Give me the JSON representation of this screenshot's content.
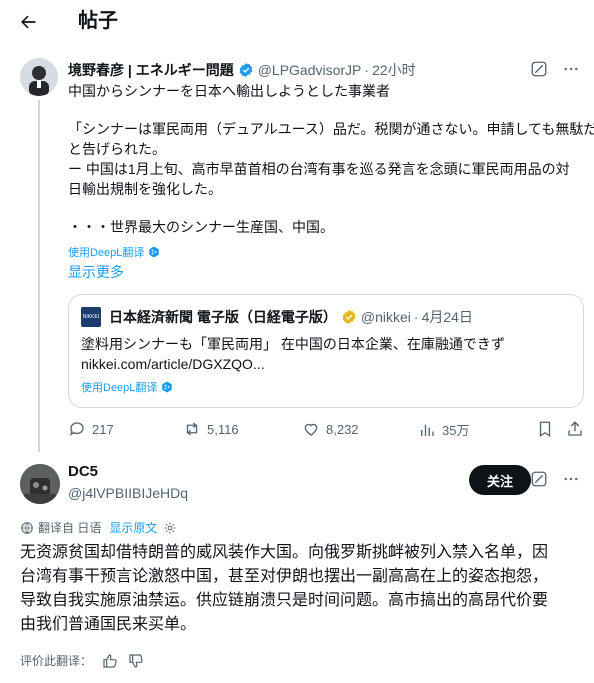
{
  "header": {
    "title": "帖子"
  },
  "post": {
    "author_name": "境野春彦 | エネルギー問題",
    "handle": "@LPGadvisorJP",
    "separator": "·",
    "time": "22小时",
    "lines": [
      "中国からシンナーを日本へ輸出しようとした事業者",
      "「シンナーは軍民両用（デュアルユース）品だ。税関が通さない。申請しても無駄だ」",
      "と告げられた。",
      "ー 中国は1月上旬、高市早苗首相の台湾有事を巡る発言を念頭に軍民両用品の対",
      "日輸出規制を強化した。",
      "・・・世界最大のシンナー生産国、中国。"
    ],
    "translate_label": "使用DeepL翻译",
    "show_more": "显示更多"
  },
  "quote": {
    "logo_text": "NIKKEI",
    "author_name": "日本経済新聞 電子版（日経電子版）",
    "handle": "@nikkei",
    "separator": "·",
    "date": "4月24日",
    "line1": "塗料用シンナーも「軍民両用」 在中国の日本企業、在庫融通できず",
    "line2": "nikkei.com/article/DGXZQO...",
    "translate_label": "使用DeepL翻译"
  },
  "actions": {
    "replies": "217",
    "reposts": "5,116",
    "likes": "8,232",
    "views": "35万"
  },
  "reply": {
    "author_name": "DC5",
    "handle": "@j4lVPBIIBIJeHDq",
    "follow_label": "关注",
    "translated_from": "翻译自 日语",
    "show_original": "显示原文",
    "lines": [
      "无资源贫国却借特朗普的威风装作大国。向俄罗斯挑衅被列入禁入名单，因",
      "台湾有事干预言论激怒中国，甚至对伊朗也摆出一副高高在上的姿态抱怨，",
      "导致自我实施原油禁运。供应链崩溃只是时间问题。高市搞出的高昂代价要",
      "由我们普通国民来买单。"
    ],
    "rate_label": "评价此翻译："
  },
  "icons": {
    "back": "arrow-left-icon",
    "verified": "verified-badge-icon",
    "grok": "grok-icon",
    "more": "more-icon",
    "deepl": "deepl-icon",
    "reply": "reply-icon",
    "repost": "repost-icon",
    "like": "heart-icon",
    "views": "views-icon",
    "bookmark": "bookmark-icon",
    "share": "share-icon",
    "translate": "translate-icon",
    "settings": "gear-icon",
    "thumbs_up": "thumbs-up-icon",
    "thumbs_down": "thumbs-down-icon"
  },
  "colors": {
    "link": "#1d9bf0",
    "verified_blue": "#1d9bf0",
    "verified_gold": "#e2b719",
    "secondary_text": "#536471",
    "button_bg": "#0f1419"
  }
}
